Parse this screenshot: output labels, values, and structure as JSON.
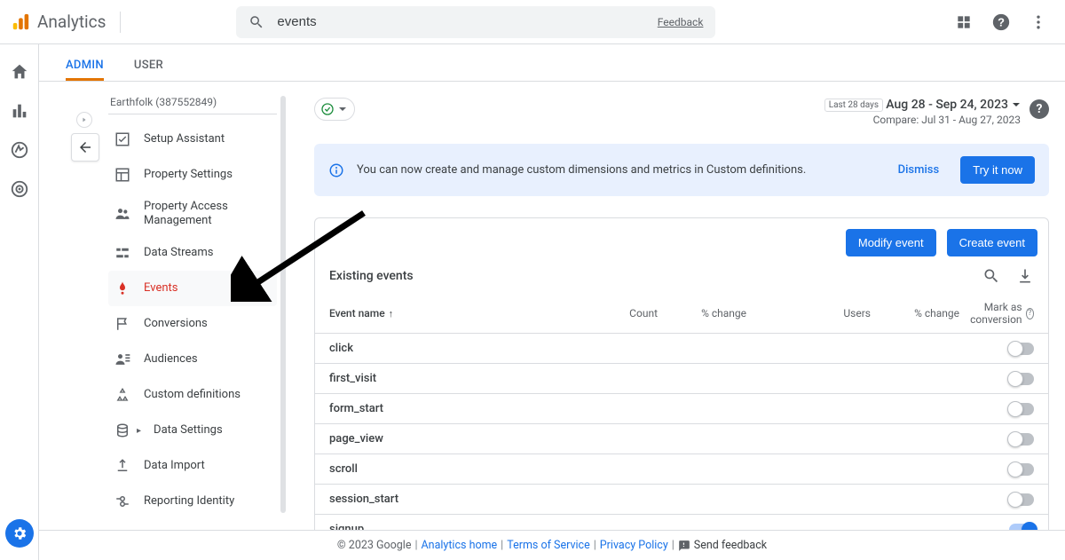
{
  "app": {
    "name": "Analytics"
  },
  "search": {
    "value": "events",
    "feedback": "Feedback"
  },
  "tabs": {
    "admin": "ADMIN",
    "user": "USER"
  },
  "property": {
    "header": "Earthfolk (387552849)",
    "items": [
      {
        "label": "Setup Assistant"
      },
      {
        "label": "Property Settings"
      },
      {
        "label": "Property Access Management"
      },
      {
        "label": "Data Streams"
      },
      {
        "label": "Events"
      },
      {
        "label": "Conversions"
      },
      {
        "label": "Audiences"
      },
      {
        "label": "Custom definitions"
      },
      {
        "label": "Data Settings",
        "expandable": true
      },
      {
        "label": "Data Import"
      },
      {
        "label": "Reporting Identity"
      }
    ]
  },
  "date": {
    "chip": "Last 28 days",
    "range": "Aug 28 - Sep 24, 2023",
    "compare": "Compare: Jul 31 - Aug 27, 2023"
  },
  "banner": {
    "text": "You can now create and manage custom dimensions and metrics in Custom definitions.",
    "dismiss": "Dismiss",
    "cta": "Try it now"
  },
  "actions": {
    "modify": "Modify event",
    "create": "Create event"
  },
  "table": {
    "title": "Existing events",
    "columns": {
      "name": "Event name",
      "count": "Count",
      "pct1": "% change",
      "users": "Users",
      "pct2": "% change",
      "mark": "Mark as conversion"
    },
    "rows": [
      {
        "name": "click",
        "conversion": false
      },
      {
        "name": "first_visit",
        "conversion": false
      },
      {
        "name": "form_start",
        "conversion": false
      },
      {
        "name": "page_view",
        "conversion": false
      },
      {
        "name": "scroll",
        "conversion": false
      },
      {
        "name": "session_start",
        "conversion": false
      },
      {
        "name": "signup",
        "conversion": true
      }
    ]
  },
  "footer": {
    "copyright": "© 2023 Google",
    "home": "Analytics home",
    "tos": "Terms of Service",
    "privacy": "Privacy Policy",
    "send": "Send feedback"
  }
}
